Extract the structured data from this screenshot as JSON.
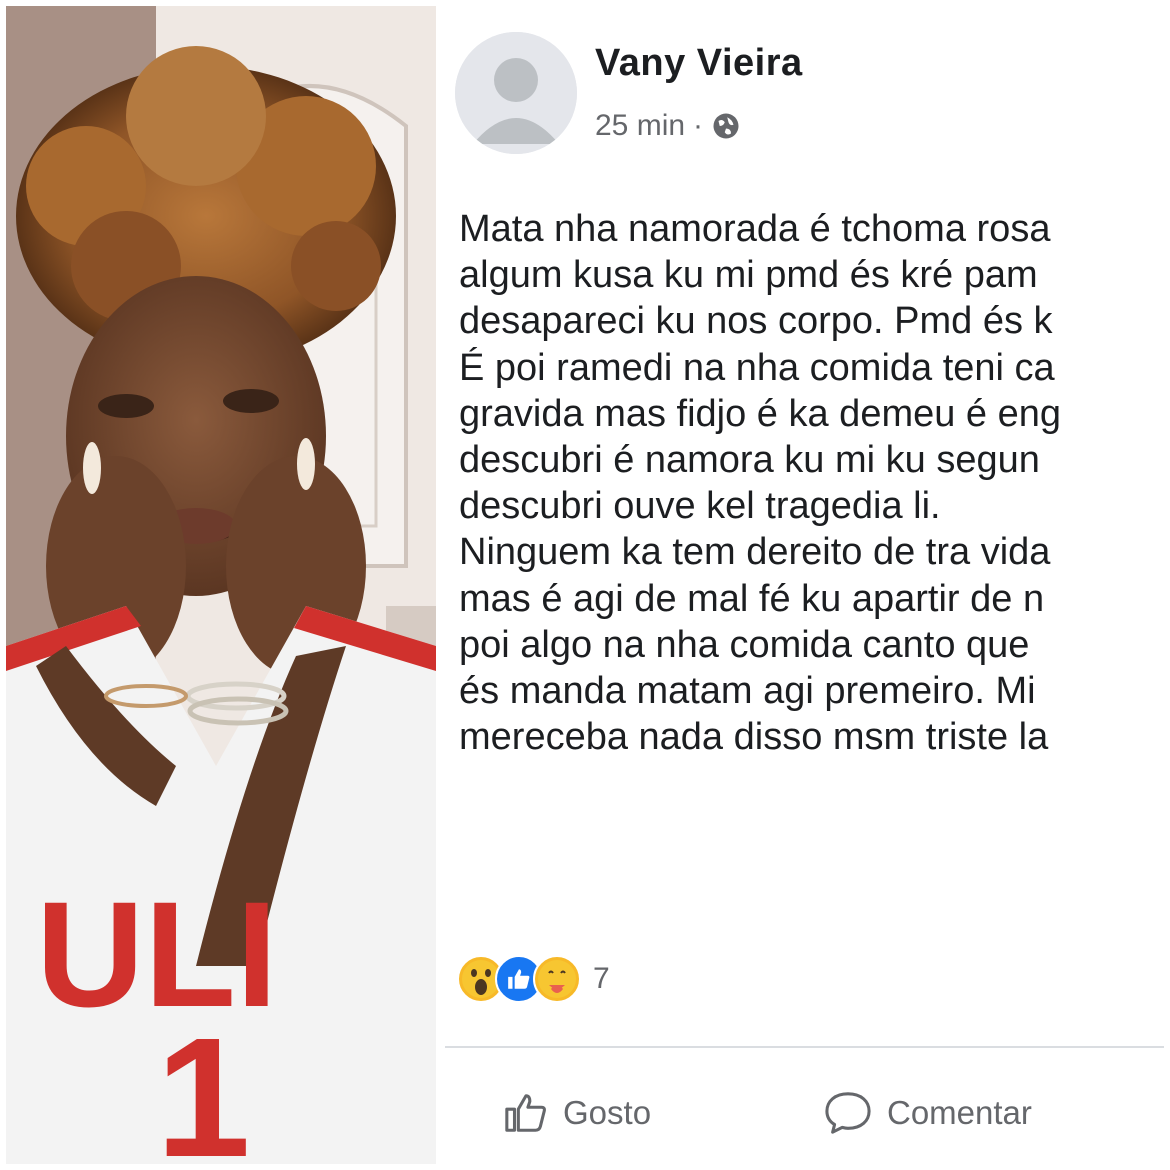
{
  "post": {
    "author": "Vany Vieira",
    "time": "25 min",
    "separator": "·",
    "privacy_icon": "globe-icon",
    "body_lines": [
      "Mata nha namorada é tchoma rosa",
      "algum kusa ku mi pmd és kré pam",
      "desapareci ku nos corpo. Pmd és k",
      "É poi ramedi na nha comida teni ca",
      "gravida mas fidjo é ka demeu é eng",
      "descubri é namora ku mi ku segun",
      "descubri ouve kel tragedia li.",
      "Ninguem ka tem dereito de tra vida",
      "mas é agi de mal fé ku apartir de n",
      "poi algo na nha comida canto que",
      "és manda matam agi premeiro. Mi",
      "mereceba nada disso msm triste la"
    ],
    "reactions": {
      "icons": [
        "wow-icon",
        "like-icon",
        "care-icon"
      ],
      "count": "7"
    },
    "actions": {
      "like_label": "Gosto",
      "comment_label": "Comentar"
    }
  },
  "photo": {
    "jersey_letters": "ULI",
    "jersey_number": "1"
  },
  "colors": {
    "text": "#1c1e21",
    "muted": "#65676b",
    "divider": "#dadde1",
    "like_blue": "#1877f2",
    "jersey_red": "#d0312d"
  }
}
